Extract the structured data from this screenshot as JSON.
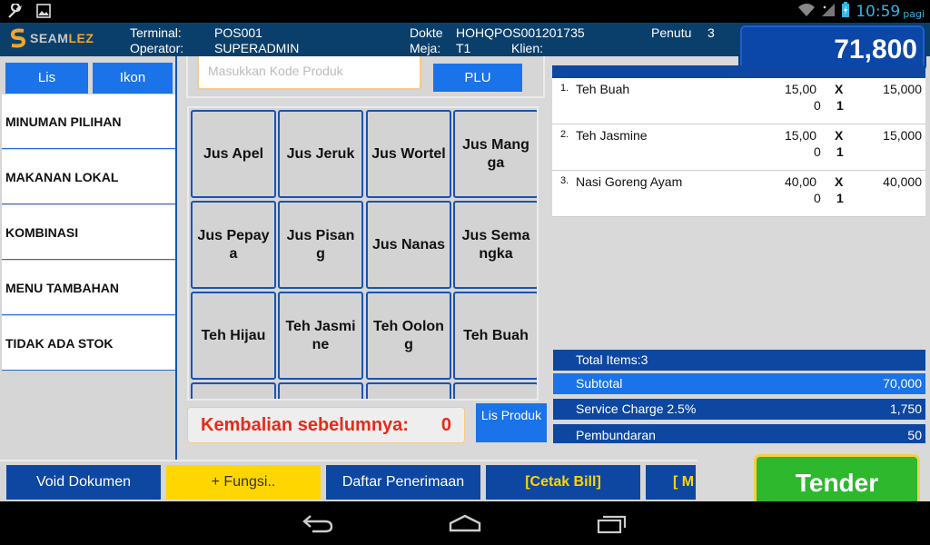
{
  "status_bar": {
    "time": "10:59",
    "period": "pagi",
    "icons": [
      "wrench-icon",
      "image-icon",
      "wifi-icon",
      "signal-icon",
      "battery-charging-icon"
    ]
  },
  "header": {
    "brand": {
      "part1": "SEAM",
      "part2": "LEZ"
    },
    "terminal_label": "Terminal:",
    "terminal_value": "POS001",
    "operator_label": "Operator:",
    "operator_value": "SUPERADMIN",
    "doc_label": "Dokte",
    "doc_value": "HOHQPOS001201735",
    "table_label": "Meja:",
    "table_value": "T1",
    "client_label": "Klien:",
    "client_value": "",
    "guests_label": "Penutu",
    "guests_value": "3",
    "total": "71,800"
  },
  "left_panel": {
    "view_tabs": [
      "Lis",
      "Ikon"
    ],
    "categories": [
      "MINUMAN PILIHAN",
      "MAKANAN LOKAL",
      "KOMBINASI",
      "MENU TAMBAHAN",
      "TIDAK ADA STOK"
    ]
  },
  "search": {
    "placeholder": "Masukkan Kode Produk",
    "plu_label": "PLU"
  },
  "products": [
    "Jus Apel",
    "Jus Jeruk",
    "Jus Wortel",
    "Jus Mangga",
    "Jus Pepaya",
    "Jus Pisang",
    "Jus Nanas",
    "Jus Semangka",
    "Teh Hijau",
    "Teh Jasmine",
    "Teh Oolong",
    "Teh Buah",
    "",
    "",
    "",
    ""
  ],
  "change": {
    "label": "Kembalian sebelumnya:",
    "value": "0"
  },
  "list_products_label": "Lis Produk",
  "order_items": [
    {
      "no": "1.",
      "name": "Teh Buah",
      "price_a": "15,00",
      "price_b": "0",
      "x": "X",
      "qty": "1",
      "amount": "15,000"
    },
    {
      "no": "2.",
      "name": "Teh Jasmine",
      "price_a": "15,00",
      "price_b": "0",
      "x": "X",
      "qty": "1",
      "amount": "15,000"
    },
    {
      "no": "3.",
      "name": "Nasi Goreng Ayam",
      "price_a": "40,00",
      "price_b": "0",
      "x": "X",
      "qty": "1",
      "amount": "40,000"
    }
  ],
  "summary": {
    "total_items": "Total Items:3",
    "subtotal_label": "Subtotal",
    "subtotal_value": "70,000",
    "service_label": "Service Charge 2.5%",
    "service_value": "1,750",
    "rounding_label": "Pembundaran",
    "rounding_value": "50"
  },
  "function_buttons": [
    "Void Dokumen",
    "+ Fungsi..",
    "Daftar Penerimaan",
    "[Cetak Bill]",
    "[ M"
  ],
  "tender_label": "Tender",
  "colors": {
    "header_bg": "#0b3f6b",
    "primary_blue": "#1a73e8",
    "dark_blue": "#0d47a1",
    "accent_yellow": "#ffd600",
    "tender_green": "#2db82d",
    "alert_red": "#e52b1a"
  }
}
